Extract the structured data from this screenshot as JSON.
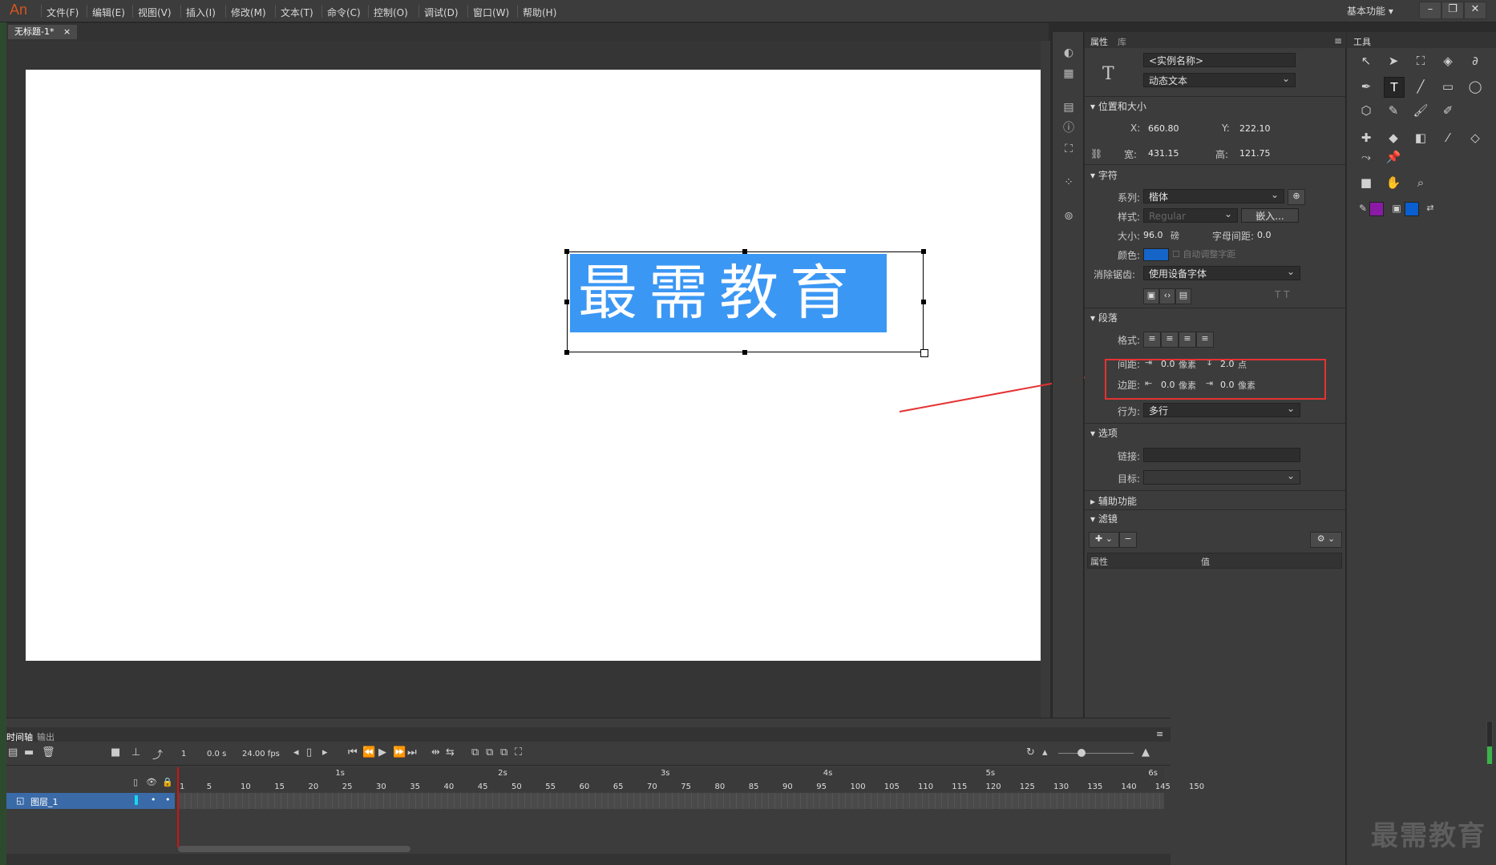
{
  "app": {
    "logo": "An",
    "menus": [
      "文件(F)",
      "编辑(E)",
      "视图(V)",
      "插入(I)",
      "修改(M)",
      "文本(T)",
      "命令(C)",
      "控制(O)",
      "调试(D)",
      "窗口(W)",
      "帮助(H)"
    ],
    "workspace": "基本功能 ▾",
    "window_controls": [
      "–",
      "❐",
      "✕"
    ]
  },
  "document": {
    "tab": "无标题-1*",
    "tab_close": "×"
  },
  "stage": {
    "text": "最需教育"
  },
  "properties": {
    "tabs": [
      "属性",
      "库"
    ],
    "instance_name_placeholder": "<实例名称>",
    "text_type": "动态文本",
    "sections": {
      "position": "位置和大小",
      "character": "字符",
      "paragraph": "段落",
      "options": "选项",
      "accessibility": "辅助功能",
      "filters": "滤镜"
    },
    "x_label": "X:",
    "x_value": "660.80",
    "y_label": "Y:",
    "y_value": "222.10",
    "w_label": "宽:",
    "w_value": "431.15",
    "h_label": "高:",
    "h_value": "121.75",
    "family_label": "系列:",
    "family_value": "楷体",
    "style_label": "样式:",
    "style_value": "Regular",
    "embed_button": "嵌入...",
    "size_label": "大小:",
    "size_value": "96.0",
    "size_unit": "磅",
    "letter_spacing_label": "字母间距:",
    "letter_spacing_value": "0.0",
    "color_label": "颜色:",
    "color_value": "#1565c8",
    "auto_kern": "自动调整字距",
    "antialias_label": "消除锯齿:",
    "antialias_value": "使用设备字体",
    "format_label": "格式:",
    "spacing_label": "间距:",
    "spacing_indent": "0.0",
    "spacing_indent_unit": "像素",
    "line_spacing": "2.0",
    "line_spacing_unit": "点",
    "margin_label": "边距:",
    "margin_left": "0.0",
    "margin_left_unit": "像素",
    "margin_right": "0.0",
    "margin_right_unit": "像素",
    "behavior_label": "行为:",
    "behavior_value": "多行",
    "link_label": "链接:",
    "target_label": "目标:",
    "filter_col_property": "属性",
    "filter_col_value": "值"
  },
  "tools": {
    "title": "工具",
    "stroke_color": "#8b1aa6",
    "fill_color": "#0a5fd0"
  },
  "timeline": {
    "tabs": [
      "时间轴",
      "输出"
    ],
    "frame": "1",
    "time": "0.0 s",
    "fps": "24.00 fps",
    "seconds": [
      "1s",
      "2s",
      "3s",
      "4s",
      "5s",
      "6s"
    ],
    "ticks": [
      "1",
      "5",
      "10",
      "15",
      "20",
      "25",
      "30",
      "35",
      "40",
      "45",
      "50",
      "55",
      "60",
      "65",
      "70",
      "75",
      "80",
      "85",
      "90",
      "95",
      "100",
      "105",
      "110",
      "115",
      "120",
      "125",
      "130",
      "135",
      "140",
      "145",
      "150"
    ],
    "layer_name": "图层_1"
  },
  "watermark": "最需教育"
}
